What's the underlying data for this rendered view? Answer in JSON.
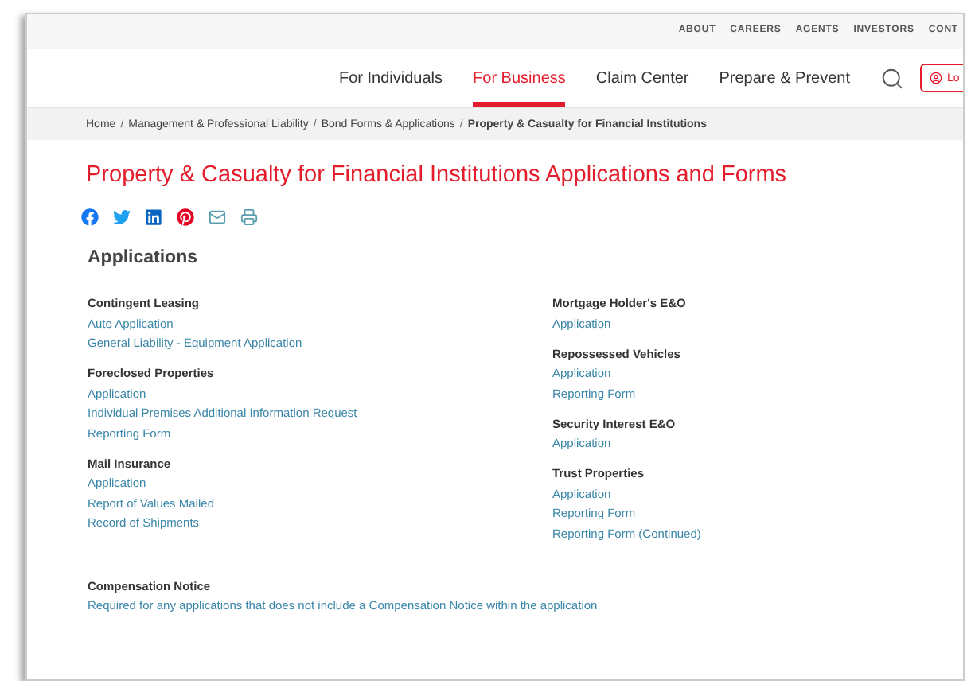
{
  "utility_links": [
    "ABOUT",
    "CAREERS",
    "AGENTS",
    "INVESTORS",
    "CONT"
  ],
  "nav": [
    {
      "label": "For Individuals",
      "selected": false
    },
    {
      "label": "For Business",
      "selected": true
    },
    {
      "label": "Claim Center",
      "selected": false
    },
    {
      "label": "Prepare & Prevent",
      "selected": false
    }
  ],
  "login_button": "Lo",
  "breadcrumb": [
    {
      "label": "Home",
      "current": false
    },
    {
      "separator": "/",
      "label": "Management & Professional Liability",
      "current": false
    },
    {
      "separator": "/",
      "label": "Bond Forms & Applications",
      "current": false
    },
    {
      "separator": "/",
      "label": "Property & Casualty for Financial Institutions",
      "current": true
    }
  ],
  "page_title": "Property & Casualty for Financial Institutions Applications and Forms",
  "section_title": "Applications",
  "columns": [
    [
      {
        "heading": "Contingent Leasing",
        "links": [
          "Auto Application",
          "General Liability - Equipment Application"
        ]
      },
      {
        "heading": "Foreclosed Properties",
        "links": [
          "Application",
          "Individual Premises Additional Information Request",
          "Reporting Form"
        ]
      },
      {
        "heading": "Mail Insurance",
        "links": [
          "Application",
          "Report of Values Mailed",
          "Record of Shipments"
        ]
      }
    ],
    [
      {
        "heading": "Mortgage Holder's E&O",
        "links": [
          "Application"
        ]
      },
      {
        "heading": "Repossessed Vehicles",
        "links": [
          "Application",
          "Reporting Form"
        ]
      },
      {
        "heading": "Security Interest E&O",
        "links": [
          "Application"
        ]
      },
      {
        "heading": "Trust Properties",
        "links": [
          "Application",
          "Reporting Form",
          "Reporting Form (Continued)"
        ]
      }
    ]
  ],
  "notice": {
    "heading": "Compensation Notice",
    "link": "Required for any applications that does not include a Compensation Notice within the application"
  }
}
